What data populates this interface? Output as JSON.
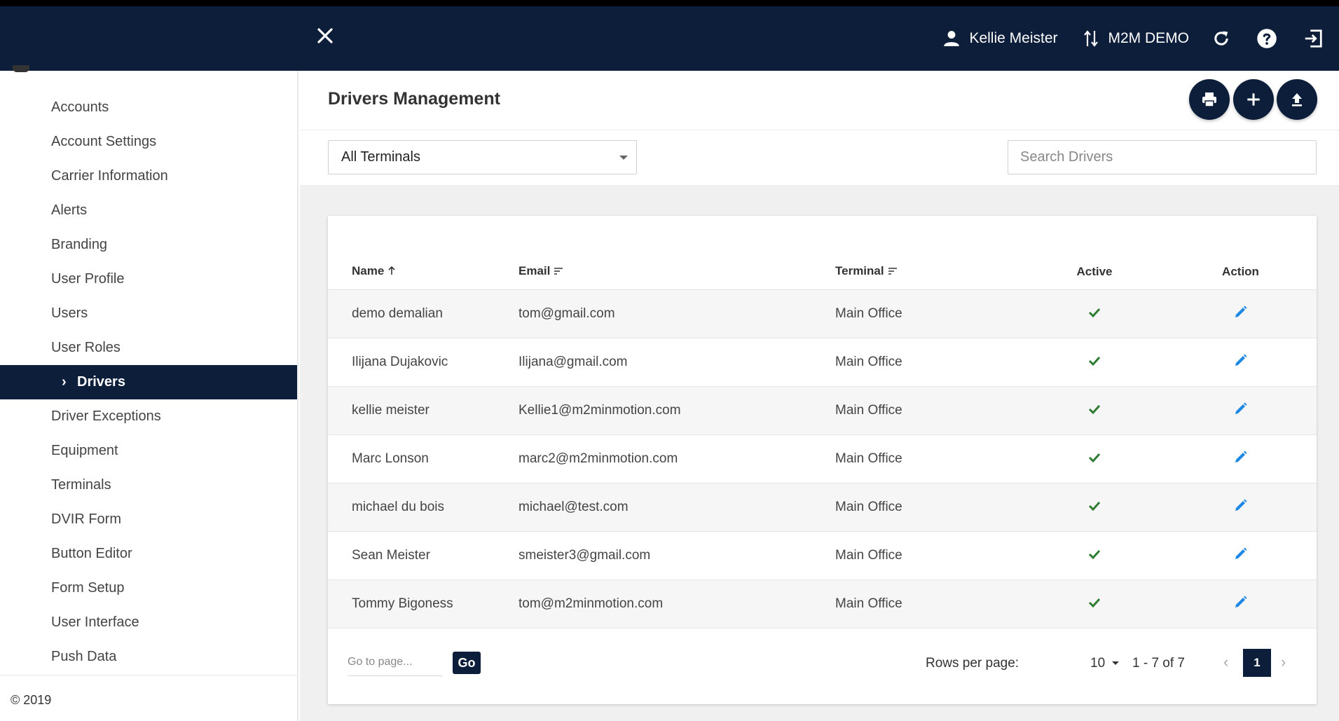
{
  "topbar": {
    "user_name": "Kellie Meister",
    "org_name": "M2M DEMO",
    "icons": [
      "close-icon",
      "user-icon",
      "switch-org-icon",
      "refresh-icon",
      "help-icon",
      "logout-icon"
    ]
  },
  "sidebar": {
    "items": [
      {
        "label": "Accounts"
      },
      {
        "label": "Account Settings"
      },
      {
        "label": "Carrier Information"
      },
      {
        "label": "Alerts"
      },
      {
        "label": "Branding"
      },
      {
        "label": "User Profile"
      },
      {
        "label": "Users"
      },
      {
        "label": "User Roles"
      },
      {
        "label": "Drivers",
        "active": true
      },
      {
        "label": "Driver Exceptions"
      },
      {
        "label": "Equipment"
      },
      {
        "label": "Terminals"
      },
      {
        "label": "DVIR Form"
      },
      {
        "label": "Button Editor"
      },
      {
        "label": "Form Setup"
      },
      {
        "label": "User Interface"
      },
      {
        "label": "Push Data"
      }
    ],
    "copyright": "© 2019"
  },
  "page": {
    "title": "Drivers Management",
    "terminal_filter": "All Terminals",
    "search_placeholder": "Search Drivers"
  },
  "table": {
    "headers": {
      "name": "Name",
      "email": "Email",
      "terminal": "Terminal",
      "active": "Active",
      "action": "Action"
    },
    "rows": [
      {
        "name": "demo demalian",
        "email": "tom@gmail.com",
        "terminal": "Main Office",
        "active": true
      },
      {
        "name": "Ilijana Dujakovic",
        "email": "Ilijana@gmail.com",
        "terminal": "Main Office",
        "active": true
      },
      {
        "name": "kellie meister",
        "email": "Kellie1@m2minmotion.com",
        "terminal": "Main Office",
        "active": true
      },
      {
        "name": "Marc Lonson",
        "email": "marc2@m2minmotion.com",
        "terminal": "Main Office",
        "active": true
      },
      {
        "name": "michael du bois",
        "email": "michael@test.com",
        "terminal": "Main Office",
        "active": true
      },
      {
        "name": "Sean Meister",
        "email": "smeister3@gmail.com",
        "terminal": "Main Office",
        "active": true
      },
      {
        "name": "Tommy Bigoness",
        "email": "tom@m2minmotion.com",
        "terminal": "Main Office",
        "active": true
      }
    ]
  },
  "pagination": {
    "goto_placeholder": "Go to page...",
    "go_label": "Go",
    "rows_per_page_label": "Rows per page:",
    "rows_per_page": "10",
    "range": "1 - 7 of 7",
    "current_page": "1"
  },
  "colors": {
    "navy": "#0c1e3a",
    "check_green": "#2e7d32",
    "edit_blue": "#1e88e5"
  }
}
